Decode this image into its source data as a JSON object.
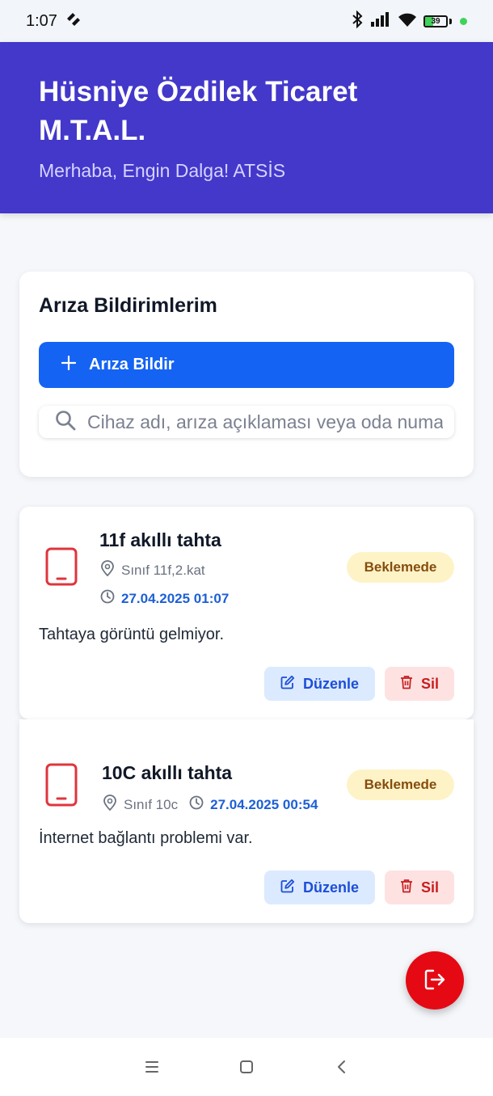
{
  "status_bar": {
    "time": "1:07",
    "battery_level": "39",
    "icons": [
      "bluetooth-icon",
      "signal-icon",
      "wifi-icon",
      "battery-icon"
    ]
  },
  "header": {
    "school_name": "Hüsniye Özdilek Ticaret M.T.A.L.",
    "greeting": "Merhaba, Engin Dalga! ATSİS"
  },
  "panel": {
    "title": "Arıza Bildirimlerim",
    "report_button_label": "Arıza Bildir",
    "search_placeholder": "Cihaz adı, arıza açıklaması veya oda numarası"
  },
  "faults": [
    {
      "device": "11f akıllı tahta",
      "location": "Sınıf 11f,2.kat",
      "date": "27.04.2025 01:07",
      "status": "Beklemede",
      "description": "Tahtaya görüntü gelmiyor.",
      "edit_label": "Düzenle",
      "delete_label": "Sil"
    },
    {
      "device": "10C akıllı tahta",
      "location": "Sınıf 10c",
      "date": "27.04.2025 00:54",
      "status": "Beklemede",
      "description": "İnternet bağlantı problemi var.",
      "edit_label": "Düzenle",
      "delete_label": "Sil"
    }
  ],
  "colors": {
    "header_bg": "#4338ca",
    "primary": "#1463f3",
    "badge_bg": "#fef3c7",
    "badge_text": "#854d0e",
    "danger": "#e50914",
    "device_icon": "#e0343c"
  }
}
